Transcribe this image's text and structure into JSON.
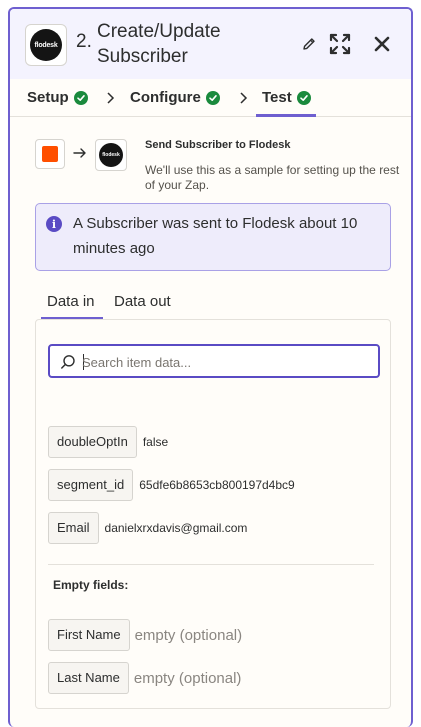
{
  "header": {
    "step_number": "2.",
    "title": "Create/Update Subscriber",
    "app_logo_text": "flodesk"
  },
  "tabs": [
    {
      "label": "Setup",
      "complete": true
    },
    {
      "label": "Configure",
      "complete": true
    },
    {
      "label": "Test",
      "complete": true,
      "active": true
    }
  ],
  "flow": {
    "title": "Send Subscriber to Flodesk",
    "description": "We'll use this as a sample for setting up the rest of your Zap.",
    "action_logo_text": "flodesk"
  },
  "banner": {
    "message": "A Subscriber was sent to Flodesk about 10 minutes ago"
  },
  "data_tabs": {
    "in_label": "Data in",
    "out_label": "Data out",
    "active": "Data in"
  },
  "search": {
    "placeholder": "Search item data..."
  },
  "fields": [
    {
      "key": "doubleOptIn",
      "value": "false"
    },
    {
      "key": "segment_id",
      "value": "65dfe6b8653cb800197d4bc9"
    },
    {
      "key": "Email",
      "value": "danielxrxdavis@gmail.com"
    }
  ],
  "empty_fields": {
    "label": "Empty fields:",
    "items": [
      {
        "key": "First Name",
        "value": "empty (optional)"
      },
      {
        "key": "Last Name",
        "value": "empty (optional)"
      }
    ]
  },
  "colors": {
    "accent": "#6e5fd0",
    "check_green": "#1a8a3d",
    "zapier_orange": "#ff4f00",
    "header_bg": "#f4f3fe",
    "banner_bg": "#eeecfb"
  }
}
